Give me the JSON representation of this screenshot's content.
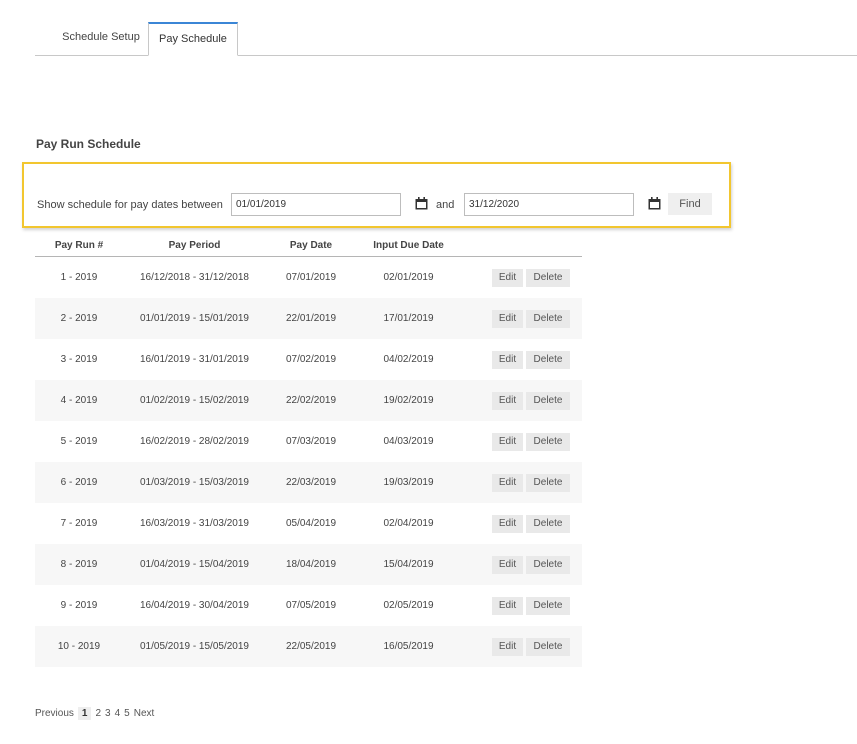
{
  "tabs": [
    {
      "label": "Schedule Setup",
      "active": false
    },
    {
      "label": "Pay Schedule",
      "active": true
    }
  ],
  "page_title": "Pay Run Schedule",
  "filter": {
    "label": "Show schedule for pay dates between",
    "from_value": "01/01/2019",
    "and_label": "and",
    "to_value": "31/12/2020",
    "find_label": "Find",
    "icon": "calendar-icon"
  },
  "table": {
    "headers": [
      "Pay Run #",
      "Pay Period",
      "Pay Date",
      "Input Due Date",
      ""
    ],
    "edit_label": "Edit",
    "delete_label": "Delete",
    "rows": [
      {
        "run": "1 - 2019",
        "period": "16/12/2018 - 31/12/2018",
        "pay_date": "07/01/2019",
        "due_date": "02/01/2019"
      },
      {
        "run": "2 - 2019",
        "period": "01/01/2019 - 15/01/2019",
        "pay_date": "22/01/2019",
        "due_date": "17/01/2019"
      },
      {
        "run": "3 - 2019",
        "period": "16/01/2019 - 31/01/2019",
        "pay_date": "07/02/2019",
        "due_date": "04/02/2019"
      },
      {
        "run": "4 - 2019",
        "period": "01/02/2019 - 15/02/2019",
        "pay_date": "22/02/2019",
        "due_date": "19/02/2019"
      },
      {
        "run": "5 - 2019",
        "period": "16/02/2019 - 28/02/2019",
        "pay_date": "07/03/2019",
        "due_date": "04/03/2019"
      },
      {
        "run": "6 - 2019",
        "period": "01/03/2019 - 15/03/2019",
        "pay_date": "22/03/2019",
        "due_date": "19/03/2019"
      },
      {
        "run": "7 - 2019",
        "period": "16/03/2019 - 31/03/2019",
        "pay_date": "05/04/2019",
        "due_date": "02/04/2019"
      },
      {
        "run": "8 - 2019",
        "period": "01/04/2019 - 15/04/2019",
        "pay_date": "18/04/2019",
        "due_date": "15/04/2019"
      },
      {
        "run": "9 - 2019",
        "period": "16/04/2019 - 30/04/2019",
        "pay_date": "07/05/2019",
        "due_date": "02/05/2019"
      },
      {
        "run": "10 - 2019",
        "period": "01/05/2019 - 15/05/2019",
        "pay_date": "22/05/2019",
        "due_date": "16/05/2019"
      }
    ]
  },
  "pagination": {
    "previous": "Previous",
    "pages": [
      "1",
      "2",
      "3",
      "4",
      "5"
    ],
    "current": "1",
    "next": "Next"
  }
}
